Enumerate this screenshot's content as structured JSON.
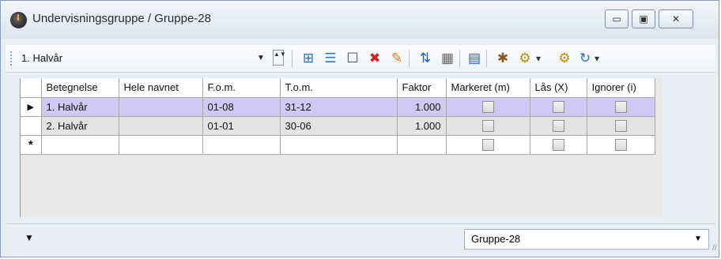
{
  "window": {
    "title": "Undervisningsgruppe / Gruppe-28",
    "minimize_label": "▭",
    "maximize_label": "▣",
    "close_label": "✕"
  },
  "toolbar": {
    "combo_value": "1. Halvår",
    "combo_arrow": "▼",
    "spin_label": "▲▼",
    "tools": [
      {
        "name": "grid-add-icon",
        "glyph": "⊞",
        "color": "#1f6fb3"
      },
      {
        "name": "list-icon",
        "glyph": "☰",
        "color": "#2a79c8"
      },
      {
        "name": "new-item-icon",
        "glyph": "☐",
        "color": "#444"
      },
      {
        "name": "delete-icon",
        "glyph": "✖",
        "color": "#d42020"
      },
      {
        "name": "edit-list-icon",
        "glyph": "✎",
        "color": "#d2781e"
      },
      {
        "name": "sort-icon",
        "glyph": "⇅",
        "color": "#2a5fb0"
      },
      {
        "name": "columns-icon",
        "glyph": "▦",
        "color": "#666"
      },
      {
        "name": "calendar-icon",
        "glyph": "▤",
        "color": "#2b5d9c"
      },
      {
        "name": "palette-icon",
        "glyph": "✱",
        "color": "#8a5b1e"
      },
      {
        "name": "settings-page-icon",
        "glyph": "⚙",
        "color": "#b0901a"
      },
      {
        "name": "dropdown-icon",
        "glyph": "▾",
        "color": "#333"
      },
      {
        "name": "gear-icon",
        "glyph": "⚙",
        "color": "#c28a12"
      },
      {
        "name": "refresh-icon",
        "glyph": "↻",
        "color": "#2f73c0"
      },
      {
        "name": "more-icon",
        "glyph": "▾",
        "color": "#333"
      }
    ]
  },
  "table": {
    "headers": [
      "Betegnelse",
      "Hele navnet",
      "F.o.m.",
      "T.o.m.",
      "Faktor",
      "Markeret (m)",
      "Lås (X)",
      "Ignorer (i)"
    ],
    "rows": [
      {
        "indicator": "▶",
        "betegnelse": "1. Halvår",
        "hele_navnet": "",
        "fom": "01-08",
        "tom": "31-12",
        "faktor": "1.000"
      },
      {
        "indicator": "",
        "betegnelse": "2. Halvår",
        "hele_navnet": "",
        "fom": "01-01",
        "tom": "30-06",
        "faktor": "1.000"
      }
    ],
    "new_row_indicator": "*"
  },
  "statusbar": {
    "left_arrow": "▼",
    "combo_value": "Gruppe-28",
    "combo_arrow": "▼",
    "resize_glyph": "//"
  },
  "colors": {
    "selected_row": "#cfc9f5",
    "title_bar": "#dde5f1"
  }
}
